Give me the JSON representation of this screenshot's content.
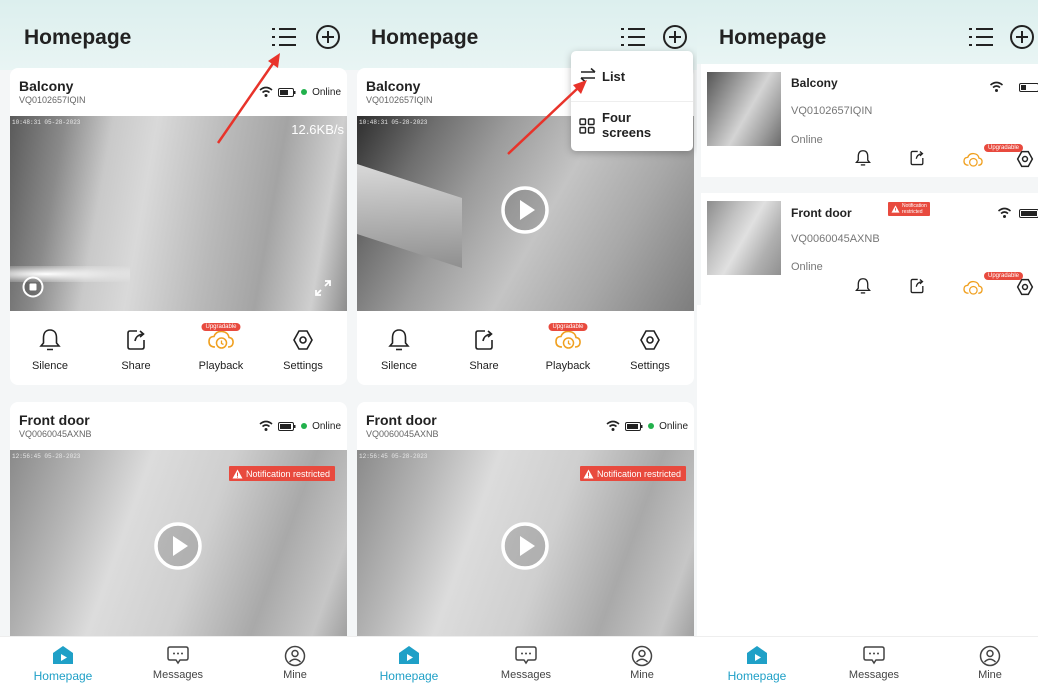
{
  "colors": {
    "accent": "#1fa0c7",
    "header": "#dcefee",
    "alert": "#e84a3e",
    "online": "#22b14c"
  },
  "header": {
    "title": "Homepage"
  },
  "devices": [
    {
      "name": "Balcony",
      "id": "VQ0102657IQIN",
      "status": "Online",
      "timestamp": "10:48:31 05-28-2023",
      "speed": "12.6KB/s"
    },
    {
      "name": "Front door",
      "id": "VQ0060045AXNB",
      "status": "Online",
      "timestamp": "12:56:45 05-28-2023",
      "notice": "Notification restricted"
    }
  ],
  "actions": {
    "silence": "Silence",
    "share": "Share",
    "playback": "Playback",
    "settings": "Settings",
    "upgradable": "Upgradable"
  },
  "menu": {
    "list": "List",
    "four_screens_line1": "Four",
    "four_screens_line2": "screens"
  },
  "list_view": {
    "upgradable": "Upgradable",
    "notif_line1": "Notification",
    "notif_line2": "restricted"
  },
  "tabs": {
    "home": "Homepage",
    "messages": "Messages",
    "mine": "Mine"
  },
  "icons": [
    "list-view-icon",
    "add-circle-icon",
    "wifi-icon",
    "battery-icon",
    "play-icon",
    "stop-icon",
    "fullscreen-icon",
    "bell-icon",
    "share-icon",
    "cloud-playback-icon",
    "settings-hex-icon",
    "warning-icon",
    "swap-icon",
    "grid-icon",
    "home-icon",
    "message-icon",
    "mine-icon"
  ]
}
